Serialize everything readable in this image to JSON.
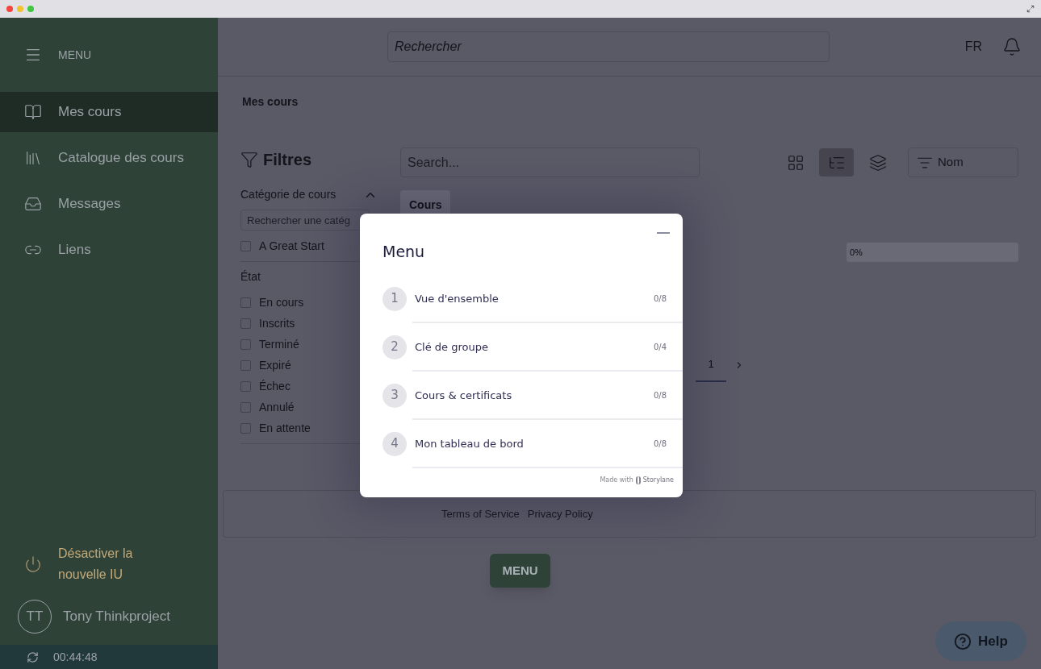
{
  "sidebar": {
    "menu_label": "MENU",
    "items": [
      {
        "kind": "book",
        "label": "Mes cours",
        "selected": true
      },
      {
        "kind": "library",
        "label": "Catalogue des cours",
        "selected": false
      },
      {
        "kind": "inbox",
        "label": "Messages",
        "selected": false
      },
      {
        "kind": "link",
        "label": "Liens",
        "selected": false
      }
    ],
    "deactivate": "Désactiver la nouvelle IU",
    "user": {
      "initials": "TT",
      "name": "Tony Thinkproject"
    },
    "timer": "00:44:48"
  },
  "header": {
    "search_placeholder": "Rechercher",
    "language": "FR"
  },
  "breadcrumb": "Mes cours",
  "filters": {
    "title": "Filtres",
    "sections": [
      {
        "label": "Catégorie de cours",
        "expanded": true,
        "search_placeholder": "Rechercher une catég",
        "options": [
          {
            "label": "A Great Start",
            "checked": false
          }
        ]
      },
      {
        "label": "État",
        "options": [
          {
            "label": "En cours",
            "checked": false
          },
          {
            "label": "Inscrits",
            "checked": false
          },
          {
            "label": "Terminé",
            "checked": false
          },
          {
            "label": "Expiré",
            "checked": false
          },
          {
            "label": "Échec",
            "checked": false
          },
          {
            "label": "Annulé",
            "checked": false
          },
          {
            "label": "En attente",
            "checked": false
          }
        ]
      }
    ]
  },
  "content": {
    "search_placeholder": "Search...",
    "views": [
      {
        "kind": "grid",
        "selected": false
      },
      {
        "kind": "tree",
        "selected": true
      },
      {
        "kind": "layers",
        "selected": false
      }
    ],
    "sort": "Nom",
    "tabs": [
      {
        "label": "Cours",
        "selected": true
      }
    ],
    "progress": {
      "level": 0,
      "reading": "0%"
    },
    "pages": [
      {
        "label": "1",
        "selected": true
      }
    ]
  },
  "footer": {
    "links": [
      "Terms of Service",
      "Privacy Policy"
    ]
  },
  "menu_button": "MENU",
  "help": "Help",
  "modal": {
    "title": "Menu",
    "items": [
      {
        "number": "1",
        "label": "Vue d'ensemble",
        "count": "0/8"
      },
      {
        "number": "2",
        "label": "Clé de groupe",
        "count": "0/4"
      },
      {
        "number": "3",
        "label": "Cours & certificats",
        "count": "0/8"
      },
      {
        "number": "4",
        "label": "Mon tableau de bord",
        "count": "0/8"
      }
    ],
    "credit": "Made with",
    "brand": "Storylane"
  }
}
